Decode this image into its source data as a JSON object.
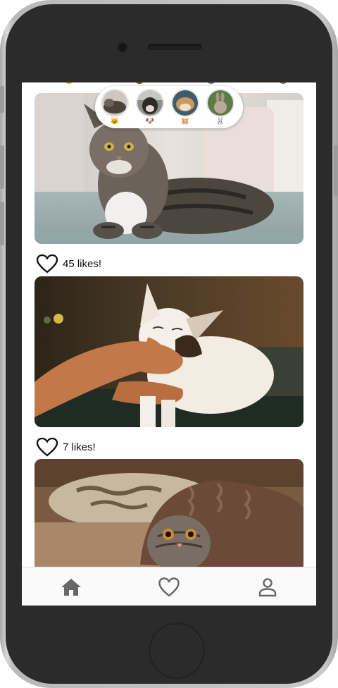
{
  "stories": [
    {
      "name": "story-cat",
      "emoji": "🐱"
    },
    {
      "name": "story-dog",
      "emoji": "🐶"
    },
    {
      "name": "story-hamster",
      "emoji": "🐹"
    },
    {
      "name": "story-rabbit",
      "emoji": "🐰"
    }
  ],
  "posts": [
    {
      "likes_text": "45 likes!",
      "image": "tabby cat lying on couch"
    },
    {
      "likes_text": "7 likes!",
      "image": "hand petting calico cat"
    },
    {
      "image": "kitten hiding under blanket"
    }
  ],
  "nav": [
    "home-icon",
    "heart-icon",
    "profile-icon"
  ],
  "colors": {
    "icon": "#666666",
    "screen_bg": "#ffffff",
    "phone_body": "#2b2b2b"
  }
}
